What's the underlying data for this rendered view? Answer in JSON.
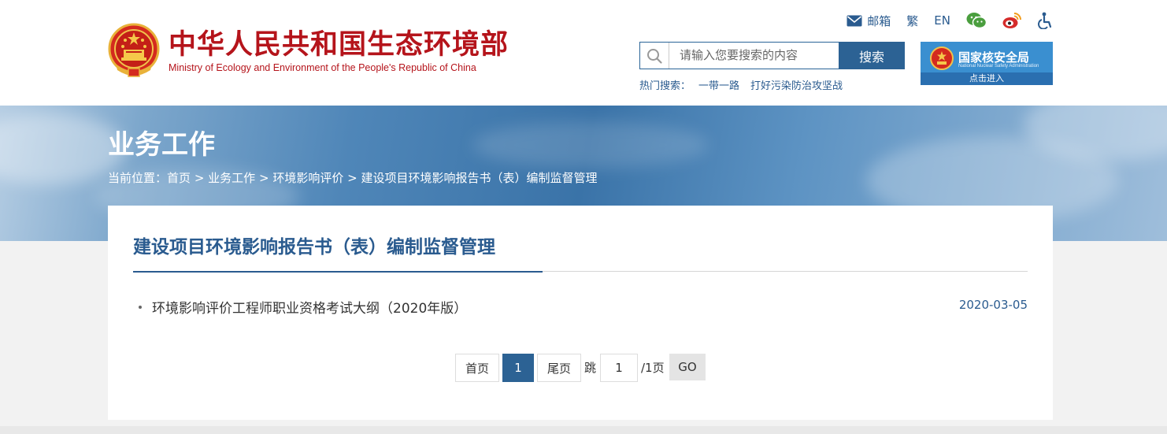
{
  "header": {
    "title": "中华人民共和国生态环境部",
    "subtitle": "Ministry of Ecology and Environment of the People's Republic of China",
    "links": {
      "mail": "邮箱",
      "traditional": "繁",
      "english": "EN"
    },
    "icons": {
      "mail": "mail-icon",
      "wechat": "wechat-icon",
      "weibo": "weibo-icon",
      "accessibility": "accessibility-icon"
    },
    "search": {
      "placeholder": "请输入您要搜索的内容",
      "button": "搜索"
    },
    "hot_search": {
      "label": "热门搜索：",
      "items": [
        "一带一路",
        "打好污染防治攻坚战"
      ]
    },
    "nnsa": {
      "name": "国家核安全局",
      "english": "National Nuclear Safety Administration",
      "enter": "点击进入"
    }
  },
  "banner": {
    "section_title": "业务工作",
    "breadcrumb": {
      "prefix": "当前位置：",
      "items": [
        "首页",
        "业务工作",
        "环境影响评价",
        "建设项目环境影响报告书（表）编制监督管理"
      ],
      "separator": ">"
    }
  },
  "content": {
    "title": "建设项目环境影响报告书（表）编制监督管理",
    "items": [
      {
        "title": "环境影响评价工程师职业资格考试大纲（2020年版）",
        "date": "2020-03-05"
      }
    ]
  },
  "pagination": {
    "first": "首页",
    "current": "1",
    "last": "尾页",
    "jump_label": "跳",
    "page_input": "1",
    "total": "/1页",
    "go": "GO"
  },
  "colors": {
    "brand_red": "#b5141b",
    "primary_blue": "#2c6294",
    "link_blue": "#2a5b8f"
  }
}
